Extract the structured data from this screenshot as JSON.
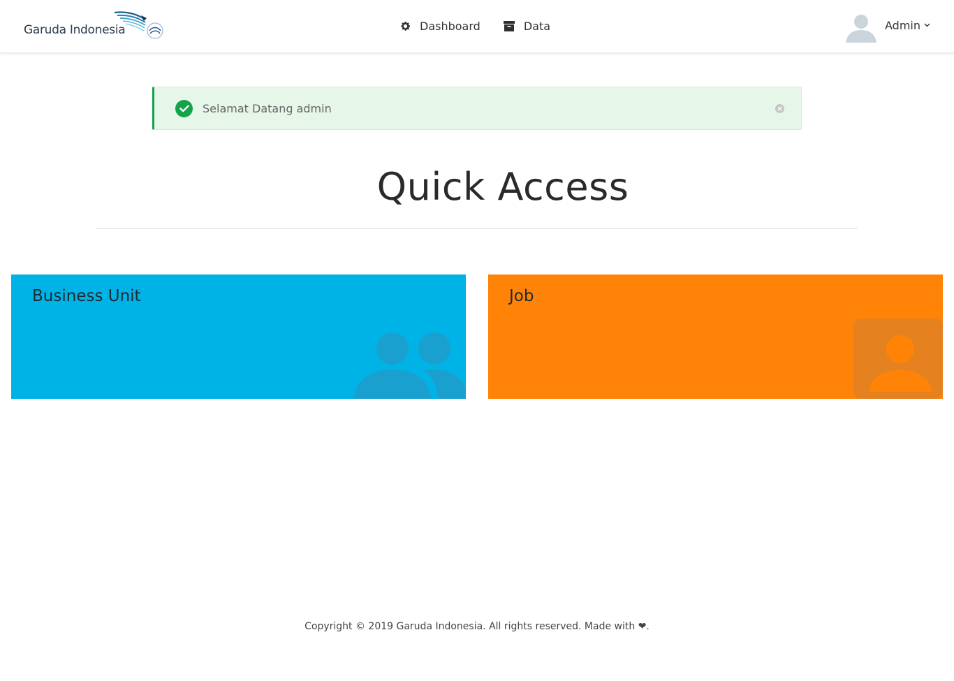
{
  "header": {
    "brand_name": "Garuda Indonesia",
    "nav": [
      {
        "label": "Dashboard",
        "icon": "gear-icon"
      },
      {
        "label": "Data",
        "icon": "archive-icon"
      }
    ],
    "user": {
      "name": "Admin",
      "avatar_icon": "user-avatar-icon",
      "caret_icon": "chevron-down-icon"
    }
  },
  "alert": {
    "message": "Selamat Datang admin",
    "icon": "check-circle-icon",
    "close_icon": "close-icon",
    "color": "#14a24a",
    "background": "#e6f6e9"
  },
  "main": {
    "title": "Quick Access",
    "cards": [
      {
        "label": "Business Unit",
        "icon": "users-icon",
        "color": "#00b3e6"
      },
      {
        "label": "Job",
        "icon": "user-icon",
        "color": "#ff8306"
      }
    ]
  },
  "footer": {
    "text": "Copyright © 2019 Garuda Indonesia. All rights reserved. Made with ❤."
  }
}
